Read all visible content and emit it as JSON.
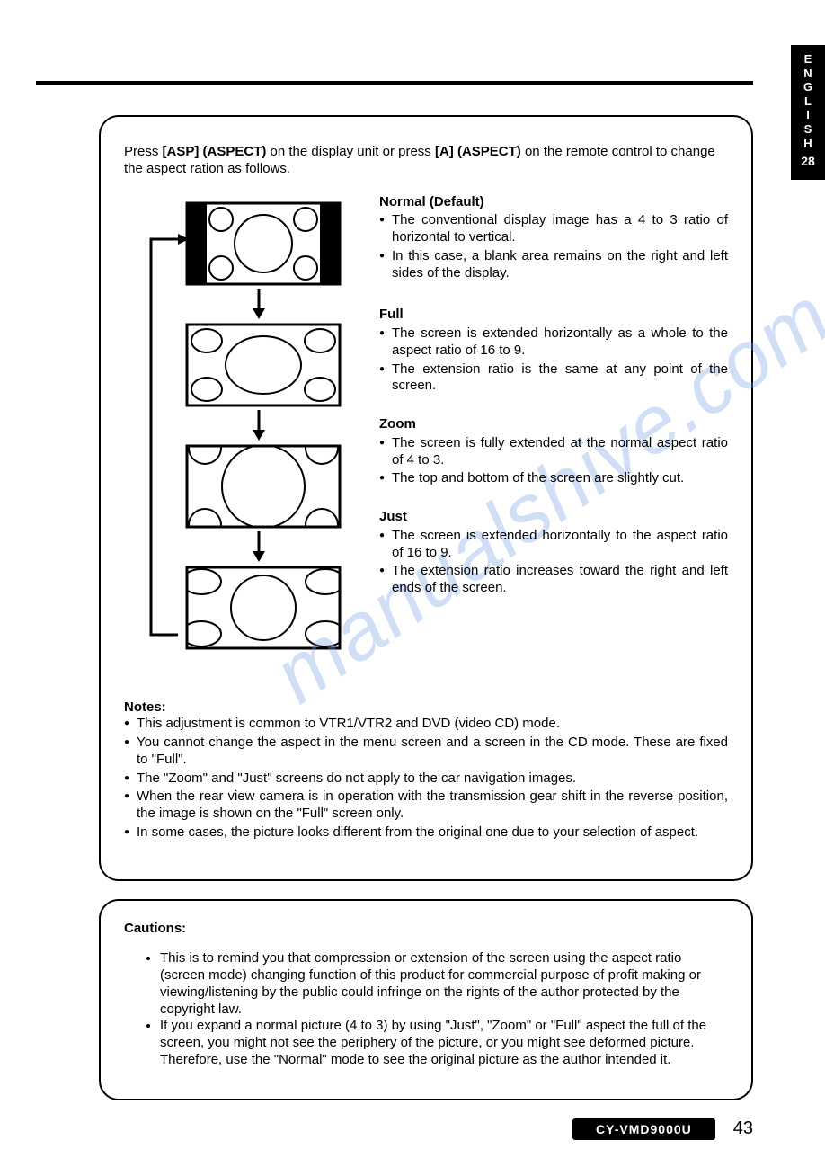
{
  "sideTab": {
    "label": "ENGLISH",
    "num": "28"
  },
  "intro": {
    "prefix": "Press ",
    "btn1": "[ASP] (ASPECT)",
    "mid": " on the display unit or press ",
    "btn2": "[A] (ASPECT)",
    "suffix": " on the remote control to change the aspect ration as follows."
  },
  "modes": [
    {
      "title": "Normal (Default)",
      "items": [
        "The conventional display image has a 4 to 3 ratio of horizontal to vertical.",
        "In this case, a blank area remains on the right and left sides of the display."
      ]
    },
    {
      "title": "Full",
      "items": [
        "The screen is extended horizontally as a whole to the aspect ratio of 16 to 9.",
        "The extension ratio is the same at any point of the screen."
      ]
    },
    {
      "title": "Zoom",
      "items": [
        "The screen is fully extended at the normal aspect ratio of 4 to 3.",
        "The top and bottom of the screen are slightly cut."
      ]
    },
    {
      "title": "Just",
      "items": [
        "The screen is extended horizontally to the aspect ratio of 16 to 9.",
        "The extension ratio increases toward the right and left ends of the screen."
      ]
    }
  ],
  "notesTitle": "Notes:",
  "notes": [
    "This adjustment is common to VTR1/VTR2 and DVD (video CD) mode.",
    "You cannot change the aspect in the menu screen and a screen in the CD mode. These are fixed to \"Full\".",
    "The \"Zoom\" and \"Just\" screens do not apply to the car navigation images.",
    "When the rear view camera is in operation with the transmission gear shift in the reverse position, the image is shown on the \"Full\" screen only.",
    "In some cases, the picture looks different from the original one due to your selection of aspect."
  ],
  "cautionsTitle": "Cautions:",
  "cautions": [
    "This is to remind you that compression or extension of the screen using the aspect ratio (screen mode) changing function of this product for commercial purpose of profit making or viewing/listening by the public could infringe on the rights of the author protected by the copyright law.",
    "If you expand a normal picture (4 to 3) by using \"Just\", \"Zoom\" or \"Full\" aspect the full of the screen, you might not see the periphery of the picture, or you might see deformed picture. Therefore, use the \"Normal\" mode to see the original picture as the author intended it."
  ],
  "model": "CY-VMD9000U",
  "pageNumber": "43",
  "watermark": "manualshive.com"
}
